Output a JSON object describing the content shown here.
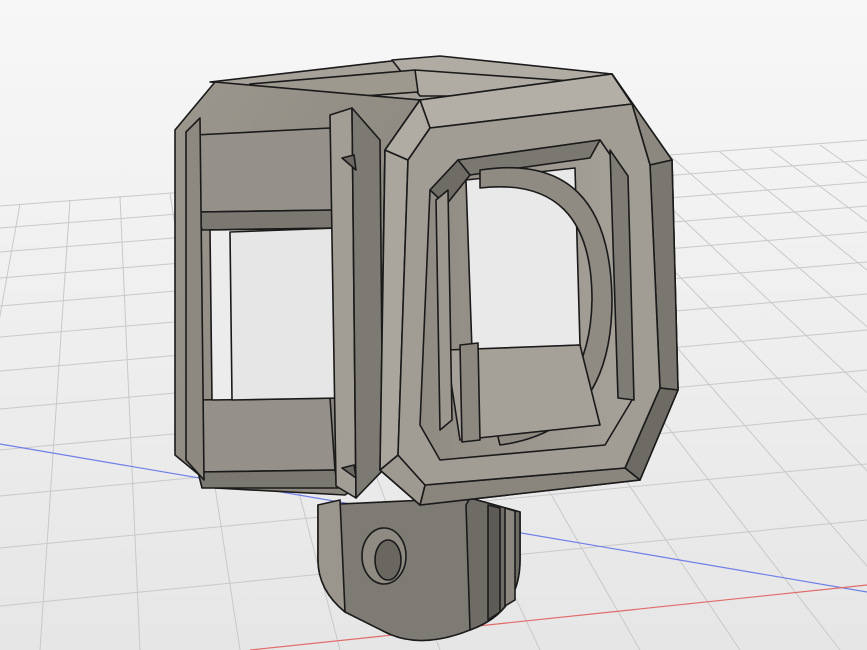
{
  "viewport": {
    "background_top": "#f6f6f6",
    "background_bottom": "#e7e7e7",
    "grid_color": "#c9c9c9",
    "axis_x_color": "#e26a6a",
    "axis_y_color": "#6f7fe8"
  },
  "model": {
    "body_color": "#8a8780",
    "face_color": "#9c988f",
    "light_color": "#a9a59c",
    "dark_color": "#6f6c66",
    "edge_color": "#1a1a1a"
  }
}
